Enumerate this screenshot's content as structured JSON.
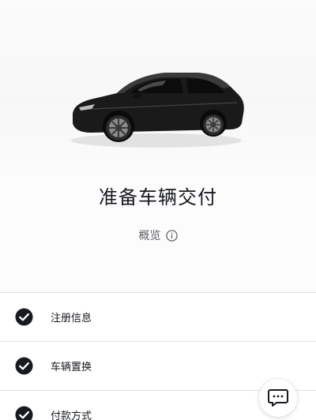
{
  "page": {
    "title": "准备车辆交付",
    "overview_label": "概览"
  },
  "steps": [
    {
      "label": "注册信息",
      "status": "completed"
    },
    {
      "label": "车辆置换",
      "status": "completed"
    },
    {
      "label": "付款方式",
      "status": "completed"
    }
  ],
  "icons": {
    "info": "info-circle-icon",
    "check": "check-circle-icon",
    "chat": "chat-bubble-icon"
  },
  "colors": {
    "text_primary": "#171a20",
    "text_secondary": "#5c5e62",
    "divider": "#e2e2e2",
    "check_fill": "#171a20"
  }
}
